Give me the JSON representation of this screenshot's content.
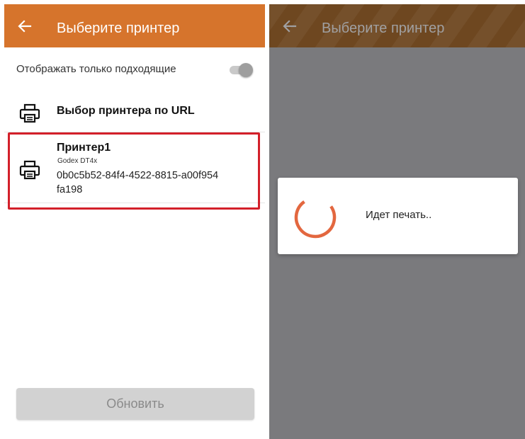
{
  "left_screen": {
    "appbar": {
      "title": "Выберите принтер",
      "back_icon": "arrow-left-icon",
      "color": "#d6742c"
    },
    "filter": {
      "label": "Отображать только подходящие",
      "switch_on": false
    },
    "items": [
      {
        "icon": "printer-icon",
        "title": "Выбор принтера по URL"
      },
      {
        "icon": "printer-icon",
        "title": "Принтер1",
        "model": "Godex DT4x",
        "id": "0b0c5b52-84f4-4522-8815-a00f954fa198",
        "highlighted": true,
        "highlight_color": "#d3202a"
      }
    ],
    "refresh_button": {
      "label": "Обновить",
      "disabled": true
    }
  },
  "right_screen": {
    "appbar": {
      "title": "Выберите принтер",
      "back_icon": "arrow-left-icon",
      "dimmed": true
    },
    "progress_dialog": {
      "message": "Идет печать..",
      "spinner_icon": "progress-spinner-icon",
      "spinner_color": "#e3673f"
    }
  }
}
